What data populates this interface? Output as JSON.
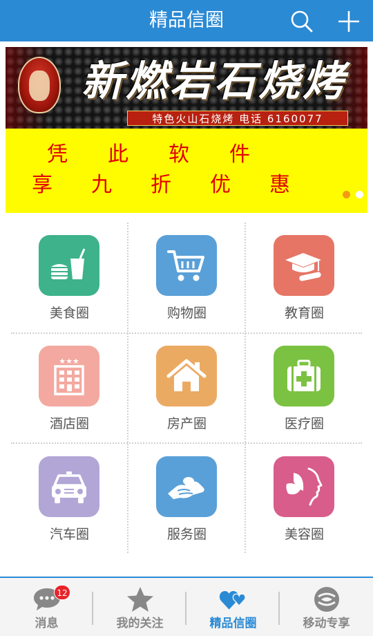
{
  "header": {
    "title": "精品信圈",
    "search_icon": "search-icon",
    "add_icon": "plus-icon",
    "bg_color": "#2b8ad4"
  },
  "banner": {
    "shop_name": "新燃岩石烧烤",
    "contact": "特色火山石烧烤 电话 6160077",
    "promo_line_1": "凭此软件",
    "promo_line_2": "享九折优惠",
    "active_slide": 1,
    "slide_count": 2
  },
  "categories": [
    {
      "label": "美食圈",
      "icon": "burger-drink-icon",
      "color": "#3db28b"
    },
    {
      "label": "购物圈",
      "icon": "shopping-cart-icon",
      "color": "#5aa0d8"
    },
    {
      "label": "教育圈",
      "icon": "graduation-cap-icon",
      "color": "#e67565"
    },
    {
      "label": "酒店圈",
      "icon": "hotel-icon",
      "color": "#f3a9a0"
    },
    {
      "label": "房产圈",
      "icon": "house-icon",
      "color": "#ebaa62"
    },
    {
      "label": "医疗圈",
      "icon": "first-aid-kit-icon",
      "color": "#7cc242"
    },
    {
      "label": "汽车圈",
      "icon": "car-icon",
      "color": "#b2a6d6"
    },
    {
      "label": "服务圈",
      "icon": "service-hand-icon",
      "color": "#5aa0d8"
    },
    {
      "label": "美容圈",
      "icon": "beauty-face-icon",
      "color": "#d85d8a"
    }
  ],
  "tabs": [
    {
      "label": "消息",
      "icon": "chat-bubble-icon",
      "badge": "12"
    },
    {
      "label": "我的关注",
      "icon": "star-icon"
    },
    {
      "label": "精品信圈",
      "icon": "hearts-icon",
      "active": true
    },
    {
      "label": "移动专享",
      "icon": "china-mobile-icon"
    }
  ]
}
